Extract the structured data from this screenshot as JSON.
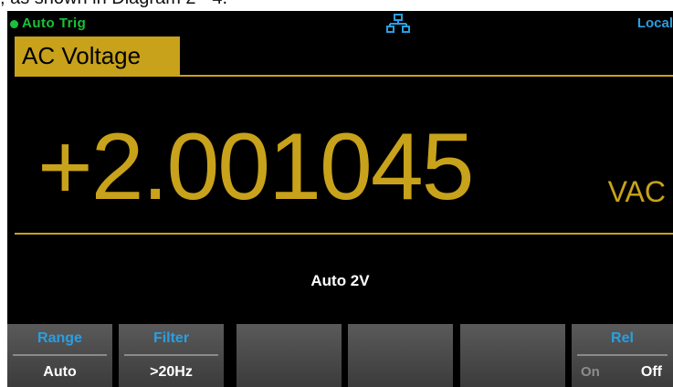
{
  "caption": ", as shown in Diagram 2 - 4.",
  "status": {
    "trigger": "Auto  Trig",
    "network_icon": "lan-icon",
    "remote": "Local",
    "trigger_color": "#19c23a",
    "remote_color": "#2a9fe0"
  },
  "function": {
    "label": "AC Voltage",
    "accent": "#c8a21a"
  },
  "measurement": {
    "reading": "+2.001045",
    "unit": "VAC",
    "range_text": "Auto  2V"
  },
  "softkeys": [
    {
      "title": "Range",
      "value": "Auto"
    },
    {
      "title": "Filter",
      "value": ">20Hz"
    },
    {
      "title": "",
      "value": ""
    },
    {
      "title": "",
      "value": ""
    },
    {
      "title": "",
      "value": ""
    },
    {
      "title": "Rel",
      "on": "On",
      "off": "Off"
    }
  ]
}
